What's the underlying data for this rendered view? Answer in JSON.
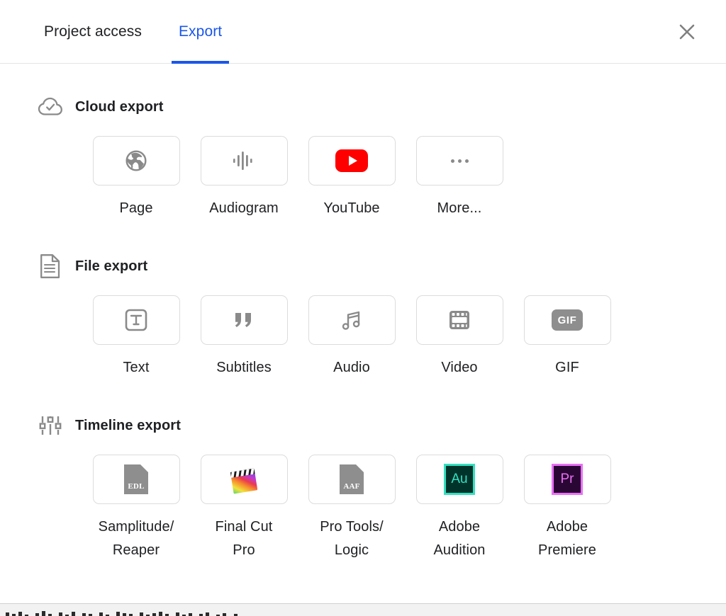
{
  "header": {
    "tabs": [
      {
        "label": "Project access",
        "active": false
      },
      {
        "label": "Export",
        "active": true
      }
    ],
    "close_icon": "close-icon",
    "accent_color": "#1a56e8"
  },
  "sections": [
    {
      "id": "cloud-export",
      "title": "Cloud export",
      "icon": "cloud-check-icon",
      "tiles": [
        {
          "label": "Page",
          "icon": "globe-icon"
        },
        {
          "label": "Audiogram",
          "icon": "waveform-icon"
        },
        {
          "label": "YouTube",
          "icon": "youtube-icon"
        },
        {
          "label": "More...",
          "icon": "ellipsis-icon"
        }
      ]
    },
    {
      "id": "file-export",
      "title": "File export",
      "icon": "document-lines-icon",
      "tiles": [
        {
          "label": "Text",
          "icon": "text-t-icon"
        },
        {
          "label": "Subtitles",
          "icon": "quote-marks-icon"
        },
        {
          "label": "Audio",
          "icon": "music-note-icon"
        },
        {
          "label": "Video",
          "icon": "filmstrip-icon"
        },
        {
          "label": "GIF",
          "icon": "gif-badge-icon",
          "badge_text": "GIF"
        }
      ]
    },
    {
      "id": "timeline-export",
      "title": "Timeline export",
      "icon": "sliders-icon",
      "tiles": [
        {
          "label": "Samplitude/\nReaper",
          "icon": "edl-file-icon",
          "badge_text": "EDL"
        },
        {
          "label": "Final Cut\nPro",
          "icon": "final-cut-pro-icon"
        },
        {
          "label": "Pro Tools/\nLogic",
          "icon": "aaf-file-icon",
          "badge_text": "AAF"
        },
        {
          "label": "Adobe\nAudition",
          "icon": "adobe-audition-icon",
          "badge_text": "Au"
        },
        {
          "label": "Adobe\nPremiere",
          "icon": "adobe-premiere-icon",
          "badge_text": "Pr"
        }
      ]
    }
  ],
  "colors": {
    "accent_blue": "#1a56e8",
    "youtube_red": "#ff0000",
    "icon_gray": "#8e8e8e",
    "text_primary": "#202124",
    "tile_border": "#dcdcdc",
    "audition_bg": "#00342b",
    "audition_fg": "#33e0c0",
    "premiere_bg": "#2a0634",
    "premiere_fg": "#ea6ff5"
  }
}
